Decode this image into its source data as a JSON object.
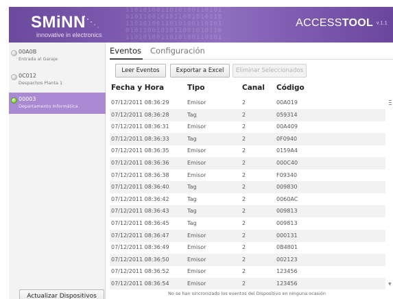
{
  "header": {
    "brand": "SMiNN",
    "tagline": "innovative in electronics",
    "product_prefix": "ACCESS",
    "product_bold": "TOOL",
    "version": "v.1.1"
  },
  "devices": [
    {
      "code": "00A0B",
      "description": "Entrada al Garaje",
      "selected": false
    },
    {
      "code": "0C012",
      "description": "Despachos Planta 1",
      "selected": false
    },
    {
      "code": "00003",
      "description": "Departamento Informática",
      "selected": true
    }
  ],
  "sidebar": {
    "update_button": "Actualizar Dispositivos"
  },
  "tabs": [
    {
      "label": "Eventos",
      "active": true
    },
    {
      "label": "Configuración",
      "active": false
    }
  ],
  "toolbar": {
    "read_label": "Leer Eventos",
    "export_label": "Exportar a Excel",
    "delete_label": "Eliminar Seleccionados"
  },
  "table": {
    "columns": [
      "Fecha y Hora",
      "Tipo",
      "Canal",
      "Código"
    ],
    "rows": [
      [
        "07/12/2011 08:36:29",
        "Emisor",
        "2",
        "00A019"
      ],
      [
        "07/12/2011 08:36:28",
        "Tag",
        "2",
        "059314"
      ],
      [
        "07/12/2011 08:36:31",
        "Emisor",
        "2",
        "00A409"
      ],
      [
        "07/12/2011 08:36:33",
        "Tag",
        "2",
        "0F0940"
      ],
      [
        "07/12/2011 08:36:35",
        "Emisor",
        "2",
        "0159A4"
      ],
      [
        "07/12/2011 08:36:36",
        "Emisor",
        "2",
        "000C40"
      ],
      [
        "07/12/2011 08:36:38",
        "Emisor",
        "2",
        "F09340"
      ],
      [
        "07/12/2011 08:36:40",
        "Tag",
        "2",
        "009830"
      ],
      [
        "07/12/2011 08:36:42",
        "Tag",
        "2",
        "0060AC"
      ],
      [
        "07/12/2011 08:36:43",
        "Tag",
        "2",
        "009813"
      ],
      [
        "07/12/2011 08:36:45",
        "Tag",
        "2",
        "009813"
      ],
      [
        "07/12/2011 08:36:47",
        "Emisor",
        "2",
        "000131"
      ],
      [
        "07/12/2011 08:36:49",
        "Emisor",
        "2",
        "0B4801"
      ],
      [
        "07/12/2011 08:36:50",
        "Emisor",
        "2",
        "002123"
      ],
      [
        "07/12/2011 08:36:52",
        "Emisor",
        "2",
        "123456"
      ],
      [
        "07/12/2011 08:36:54",
        "Emisor",
        "2",
        "123456"
      ]
    ]
  },
  "status_text": "No se han sincronizado los eventos del Dispositivo en ninguna ocasión",
  "colors": {
    "header": "#7d5cb0",
    "selected_device": "#a98ad2",
    "status_online": "#8bd43e"
  }
}
